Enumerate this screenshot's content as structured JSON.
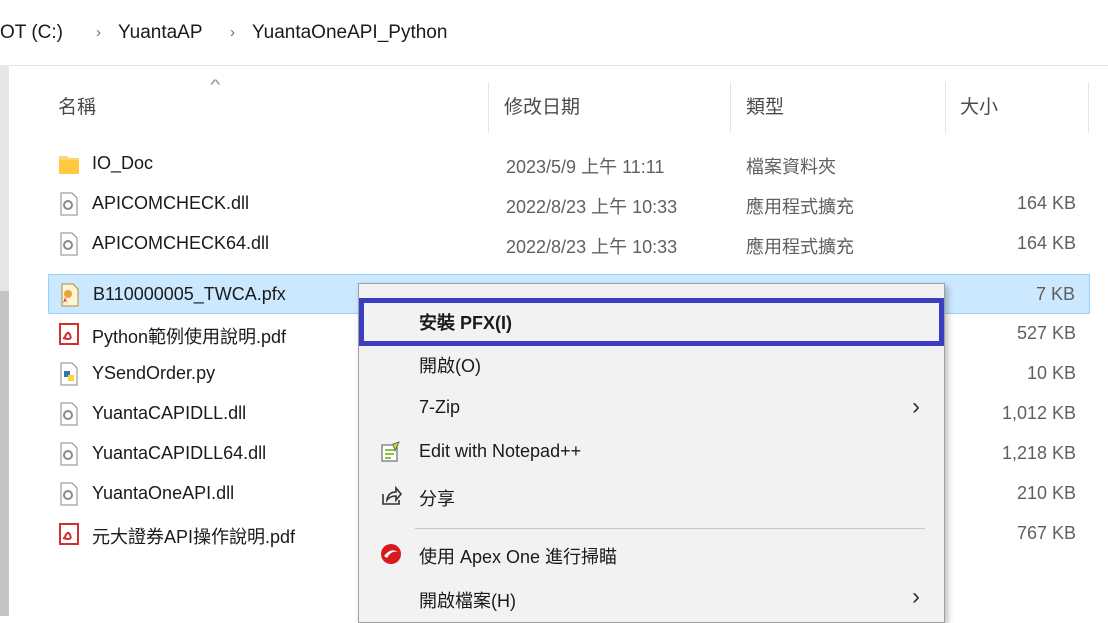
{
  "breadcrumb": {
    "items": [
      "OT (C:)",
      "YuantaAP",
      "YuantaOneAPI_Python"
    ],
    "separator": "›"
  },
  "columns": {
    "name": "名稱",
    "date": "修改日期",
    "type": "類型",
    "size": "大小",
    "sort_indicator": "^"
  },
  "files": [
    {
      "name": "IO_Doc",
      "date": "2023/5/9 上午 11:11",
      "type": "檔案資料夾",
      "size": "",
      "icon": "folder-icon"
    },
    {
      "name": "APICOMCHECK.dll",
      "date": "2022/8/23 上午 10:33",
      "type": "應用程式擴充",
      "size": "164 KB",
      "icon": "dll-file-icon"
    },
    {
      "name": "APICOMCHECK64.dll",
      "date": "2022/8/23 上午 10:33",
      "type": "應用程式擴充",
      "size": "164 KB",
      "icon": "dll-file-icon"
    },
    {
      "name": "B110000005_TWCA.pfx",
      "date": "",
      "type": "",
      "size": "7 KB",
      "icon": "certificate-file-icon",
      "selected": true
    },
    {
      "name": "Python範例使用說明.pdf",
      "date": "",
      "type": "",
      "size": "527 KB",
      "icon": "pdf-file-icon"
    },
    {
      "name": "YSendOrder.py",
      "date": "",
      "type": "",
      "size": "10 KB",
      "icon": "python-file-icon"
    },
    {
      "name": "YuantaCAPIDLL.dll",
      "date": "",
      "type": "",
      "size": "1,012 KB",
      "icon": "dll-file-icon"
    },
    {
      "name": "YuantaCAPIDLL64.dll",
      "date": "",
      "type": "",
      "size": "1,218 KB",
      "icon": "dll-file-icon"
    },
    {
      "name": "YuantaOneAPI.dll",
      "date": "",
      "type": "",
      "size": "210 KB",
      "icon": "dll-file-icon"
    },
    {
      "name": "元大證券API操作說明.pdf",
      "date": "",
      "type": "",
      "size": "767 KB",
      "icon": "pdf-file-icon"
    }
  ],
  "context_menu": {
    "items": [
      {
        "label": "安裝 PFX(I)",
        "bold": true,
        "highlighted": true
      },
      {
        "label": "開啟(O)"
      },
      {
        "label": "7-Zip",
        "submenu": true
      },
      {
        "label": "Edit with Notepad++",
        "icon": "notepad-plus-plus-icon"
      },
      {
        "label": "分享",
        "icon": "share-icon"
      },
      {
        "label": "使用 Apex One 進行掃瞄",
        "icon": "apex-one-icon"
      },
      {
        "label": "開啟檔案(H)",
        "submenu": true
      }
    ]
  },
  "colors": {
    "selection_bg": "#cce8ff",
    "highlight_border": "#3d3dbf",
    "menu_bg": "#f2f2f2"
  }
}
